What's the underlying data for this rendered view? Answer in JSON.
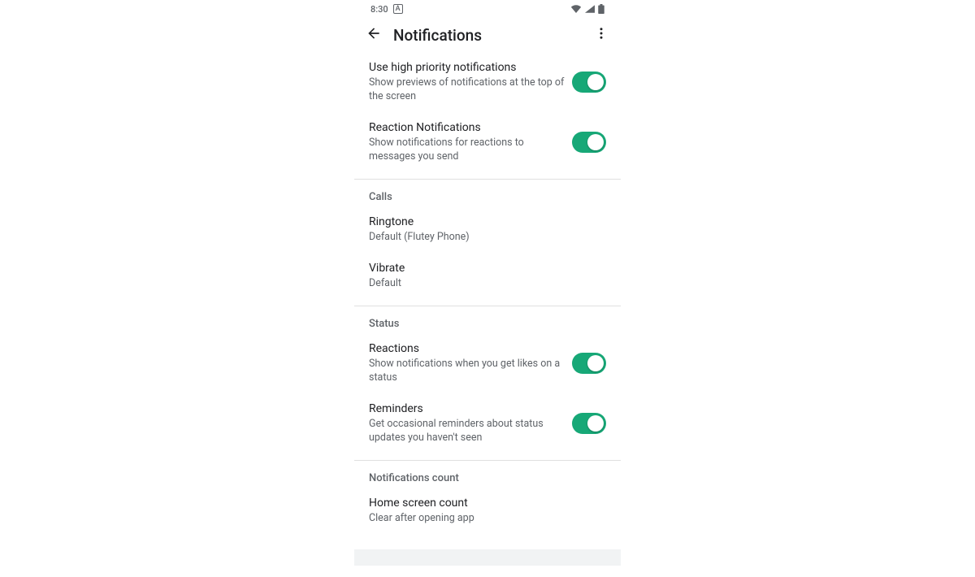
{
  "statusbar": {
    "time": "8:30",
    "app_badge": "A"
  },
  "appbar": {
    "title": "Notifications"
  },
  "items": {
    "high_priority": {
      "title": "Use high priority notifications",
      "sub": "Show previews of notifications at the top of the screen",
      "on": true
    },
    "reaction_notifications": {
      "title": "Reaction Notifications",
      "sub": "Show notifications for reactions to messages you send",
      "on": true
    }
  },
  "sections": {
    "calls": {
      "header": "Calls",
      "ringtone": {
        "title": "Ringtone",
        "sub": "Default (Flutey Phone)"
      },
      "vibrate": {
        "title": "Vibrate",
        "sub": "Default"
      }
    },
    "status": {
      "header": "Status",
      "reactions": {
        "title": "Reactions",
        "sub": "Show notifications when you get likes on a status",
        "on": true
      },
      "reminders": {
        "title": "Reminders",
        "sub": "Get occasional reminders about status updates you haven't seen",
        "on": true
      }
    },
    "count": {
      "header": "Notifications count",
      "home_screen": {
        "title": "Home screen count",
        "sub": "Clear after opening app"
      }
    }
  }
}
